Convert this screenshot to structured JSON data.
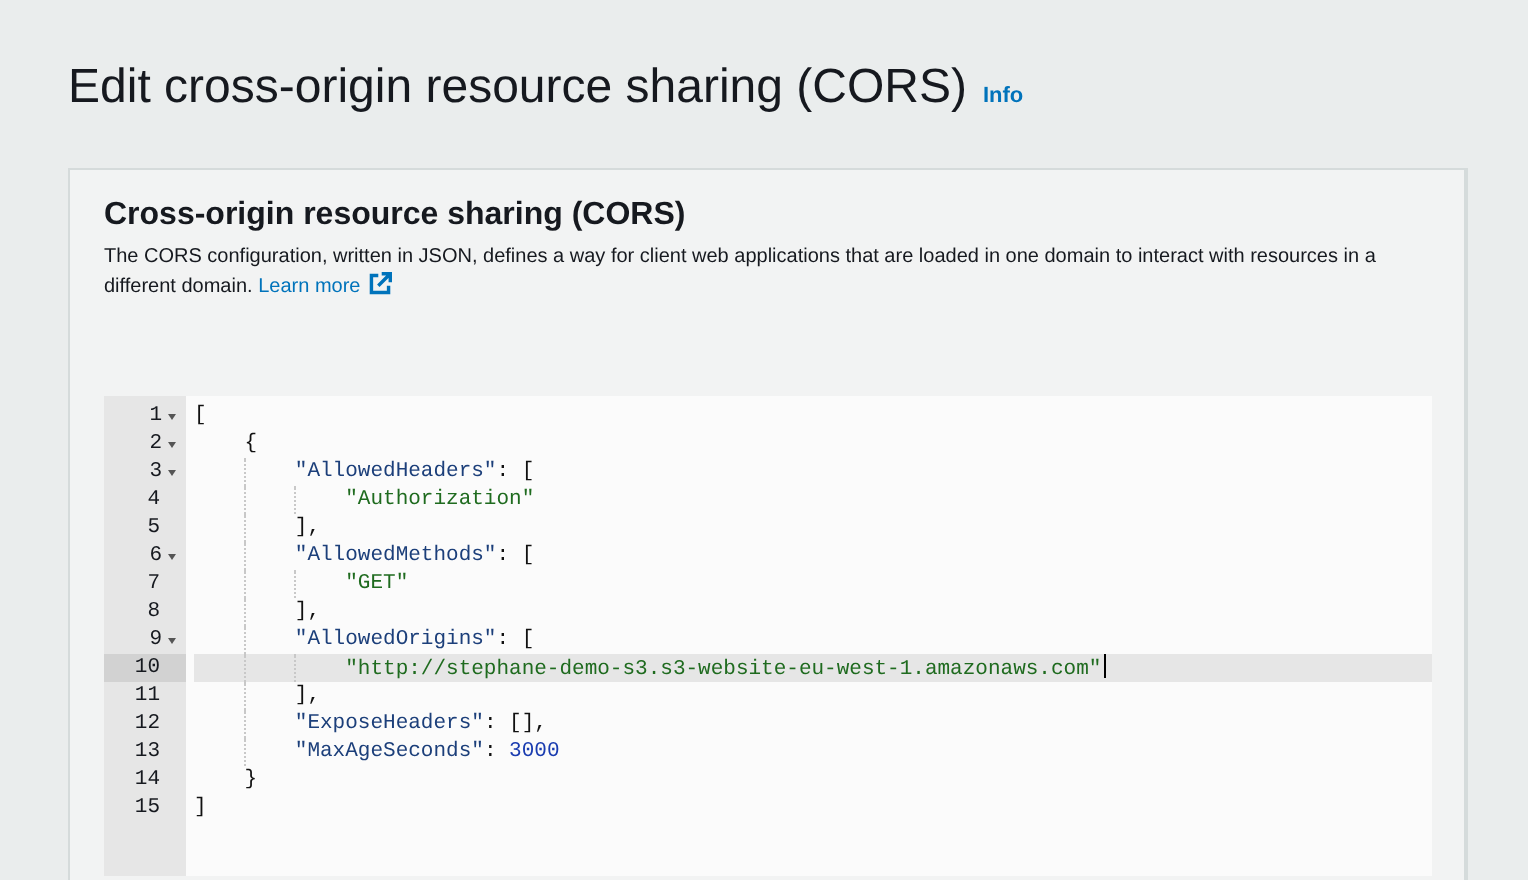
{
  "page": {
    "title": "Edit cross-origin resource sharing (CORS)",
    "info_link": "Info"
  },
  "panel": {
    "heading": "Cross-origin resource sharing (CORS)",
    "description": "The CORS configuration, written in JSON, defines a way for client web applications that are loaded in one domain to interact with resources in a different domain.",
    "learn_more": "Learn more"
  },
  "editor": {
    "lines": [
      {
        "number": "1",
        "foldable": true,
        "active": false,
        "tokens": [
          {
            "kind": "punct",
            "text": "["
          }
        ]
      },
      {
        "number": "2",
        "foldable": true,
        "active": false,
        "tokens": [
          {
            "kind": "punct",
            "text": "    {"
          }
        ]
      },
      {
        "number": "3",
        "foldable": true,
        "active": false,
        "tokens": [
          {
            "kind": "key",
            "text": "        \"AllowedHeaders\""
          },
          {
            "kind": "punct",
            "text": ": ["
          }
        ]
      },
      {
        "number": "4",
        "foldable": false,
        "active": false,
        "tokens": [
          {
            "kind": "string",
            "text": "            \"Authorization\""
          }
        ]
      },
      {
        "number": "5",
        "foldable": false,
        "active": false,
        "tokens": [
          {
            "kind": "punct",
            "text": "        ],"
          }
        ]
      },
      {
        "number": "6",
        "foldable": true,
        "active": false,
        "tokens": [
          {
            "kind": "key",
            "text": "        \"AllowedMethods\""
          },
          {
            "kind": "punct",
            "text": ": ["
          }
        ]
      },
      {
        "number": "7",
        "foldable": false,
        "active": false,
        "tokens": [
          {
            "kind": "string",
            "text": "            \"GET\""
          }
        ]
      },
      {
        "number": "8",
        "foldable": false,
        "active": false,
        "tokens": [
          {
            "kind": "punct",
            "text": "        ],"
          }
        ]
      },
      {
        "number": "9",
        "foldable": true,
        "active": false,
        "tokens": [
          {
            "kind": "key",
            "text": "        \"AllowedOrigins\""
          },
          {
            "kind": "punct",
            "text": ": ["
          }
        ]
      },
      {
        "number": "10",
        "foldable": false,
        "active": true,
        "tokens": [
          {
            "kind": "string",
            "text": "            \"http://stephane-demo-s3.s3-website-eu-west-1.amazonaws.com\""
          }
        ]
      },
      {
        "number": "11",
        "foldable": false,
        "active": false,
        "tokens": [
          {
            "kind": "punct",
            "text": "        ],"
          }
        ]
      },
      {
        "number": "12",
        "foldable": false,
        "active": false,
        "tokens": [
          {
            "kind": "key",
            "text": "        \"ExposeHeaders\""
          },
          {
            "kind": "punct",
            "text": ": [],"
          }
        ]
      },
      {
        "number": "13",
        "foldable": false,
        "active": false,
        "tokens": [
          {
            "kind": "key",
            "text": "        \"MaxAgeSeconds\""
          },
          {
            "kind": "punct",
            "text": ": "
          },
          {
            "kind": "number",
            "text": "3000"
          }
        ]
      },
      {
        "number": "14",
        "foldable": false,
        "active": false,
        "tokens": [
          {
            "kind": "punct",
            "text": "    }"
          }
        ]
      },
      {
        "number": "15",
        "foldable": false,
        "active": false,
        "tokens": [
          {
            "kind": "punct",
            "text": "]"
          }
        ]
      }
    ]
  }
}
